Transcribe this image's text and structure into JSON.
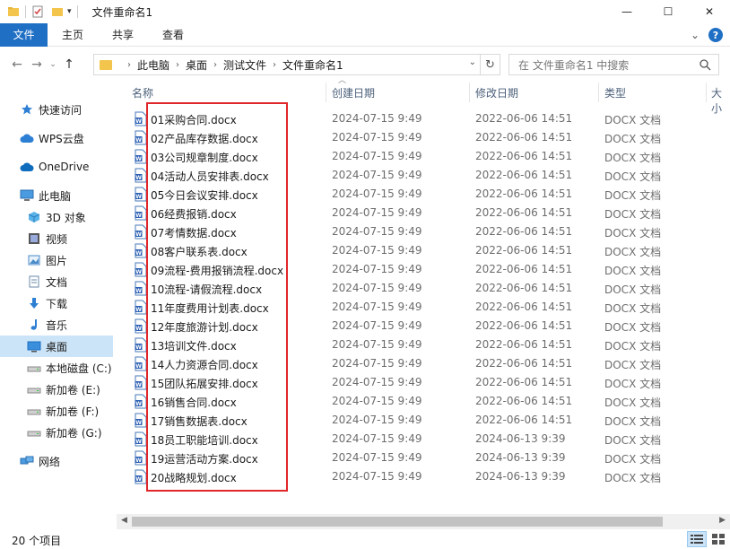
{
  "window": {
    "title": "文件重命名1",
    "minimize": "—",
    "maximize": "☐",
    "close": "✕"
  },
  "ribbon": {
    "tabs": [
      "文件",
      "主页",
      "共享",
      "查看"
    ],
    "expand": "⌄",
    "help": "?"
  },
  "address": {
    "breadcrumbs": [
      "此电脑",
      "桌面",
      "测试文件",
      "文件重命名1"
    ],
    "search_placeholder": "在 文件重命名1 中搜索"
  },
  "nav": {
    "items": [
      {
        "label": "快速访问",
        "icon": "star-icon"
      },
      {
        "label": "WPS云盘",
        "icon": "cloud-icon"
      },
      {
        "label": "OneDrive",
        "icon": "onedrive-icon"
      },
      {
        "label": "此电脑",
        "icon": "computer-icon"
      },
      {
        "label": "3D 对象",
        "icon": "cube-icon"
      },
      {
        "label": "视频",
        "icon": "video-icon"
      },
      {
        "label": "图片",
        "icon": "picture-icon"
      },
      {
        "label": "文档",
        "icon": "document-icon"
      },
      {
        "label": "下载",
        "icon": "download-icon"
      },
      {
        "label": "音乐",
        "icon": "music-icon"
      },
      {
        "label": "桌面",
        "icon": "desktop-icon",
        "selected": true
      },
      {
        "label": "本地磁盘 (C:)",
        "icon": "drive-icon"
      },
      {
        "label": "新加卷 (E:)",
        "icon": "drive-icon"
      },
      {
        "label": "新加卷 (F:)",
        "icon": "drive-icon"
      },
      {
        "label": "新加卷 (G:)",
        "icon": "drive-icon"
      },
      {
        "label": "网络",
        "icon": "network-icon"
      }
    ]
  },
  "columns": [
    "名称",
    "创建日期",
    "修改日期",
    "类型",
    "大小"
  ],
  "files": [
    {
      "name": "01采购合同.docx",
      "created": "2024-07-15 9:49",
      "modified": "2022-06-06 14:51",
      "type": "DOCX 文档"
    },
    {
      "name": "02产品库存数据.docx",
      "created": "2024-07-15 9:49",
      "modified": "2022-06-06 14:51",
      "type": "DOCX 文档"
    },
    {
      "name": "03公司规章制度.docx",
      "created": "2024-07-15 9:49",
      "modified": "2022-06-06 14:51",
      "type": "DOCX 文档"
    },
    {
      "name": "04活动人员安排表.docx",
      "created": "2024-07-15 9:49",
      "modified": "2022-06-06 14:51",
      "type": "DOCX 文档"
    },
    {
      "name": "05今日会议安排.docx",
      "created": "2024-07-15 9:49",
      "modified": "2022-06-06 14:51",
      "type": "DOCX 文档"
    },
    {
      "name": "06经费报销.docx",
      "created": "2024-07-15 9:49",
      "modified": "2022-06-06 14:51",
      "type": "DOCX 文档"
    },
    {
      "name": "07考情数据.docx",
      "created": "2024-07-15 9:49",
      "modified": "2022-06-06 14:51",
      "type": "DOCX 文档"
    },
    {
      "name": "08客户联系表.docx",
      "created": "2024-07-15 9:49",
      "modified": "2022-06-06 14:51",
      "type": "DOCX 文档"
    },
    {
      "name": "09流程-费用报销流程.docx",
      "created": "2024-07-15 9:49",
      "modified": "2022-06-06 14:51",
      "type": "DOCX 文档"
    },
    {
      "name": "10流程-请假流程.docx",
      "created": "2024-07-15 9:49",
      "modified": "2022-06-06 14:51",
      "type": "DOCX 文档"
    },
    {
      "name": "11年度费用计划表.docx",
      "created": "2024-07-15 9:49",
      "modified": "2022-06-06 14:51",
      "type": "DOCX 文档"
    },
    {
      "name": "12年度旅游计划.docx",
      "created": "2024-07-15 9:49",
      "modified": "2022-06-06 14:51",
      "type": "DOCX 文档"
    },
    {
      "name": "13培训文件.docx",
      "created": "2024-07-15 9:49",
      "modified": "2022-06-06 14:51",
      "type": "DOCX 文档"
    },
    {
      "name": "14人力资源合同.docx",
      "created": "2024-07-15 9:49",
      "modified": "2022-06-06 14:51",
      "type": "DOCX 文档"
    },
    {
      "name": "15团队拓展安排.docx",
      "created": "2024-07-15 9:49",
      "modified": "2022-06-06 14:51",
      "type": "DOCX 文档"
    },
    {
      "name": "16销售合同.docx",
      "created": "2024-07-15 9:49",
      "modified": "2022-06-06 14:51",
      "type": "DOCX 文档"
    },
    {
      "name": "17销售数据表.docx",
      "created": "2024-07-15 9:49",
      "modified": "2022-06-06 14:51",
      "type": "DOCX 文档"
    },
    {
      "name": "18员工职能培训.docx",
      "created": "2024-07-15 9:49",
      "modified": "2024-06-13 9:39",
      "type": "DOCX 文档"
    },
    {
      "name": "19运营活动方案.docx",
      "created": "2024-07-15 9:49",
      "modified": "2024-06-13 9:39",
      "type": "DOCX 文档"
    },
    {
      "name": "20战略规划.docx",
      "created": "2024-07-15 9:49",
      "modified": "2024-06-13 9:39",
      "type": "DOCX 文档"
    }
  ],
  "status": {
    "count": "20 个项目"
  },
  "colors": {
    "accent": "#1f6fc5",
    "selection": "#cce4f7",
    "highlight_box": "#e0262a"
  }
}
